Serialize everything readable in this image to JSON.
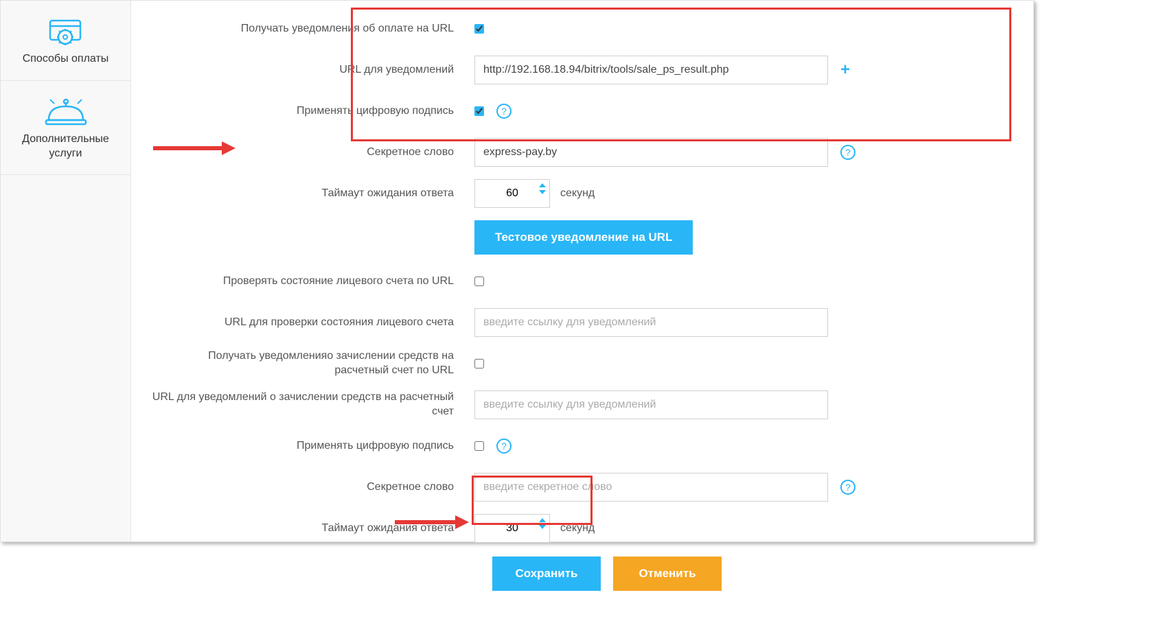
{
  "sidebar": {
    "items": [
      {
        "label": "Способы оплаты"
      },
      {
        "label": "Дополнительные услуги"
      }
    ]
  },
  "form": {
    "notify_url_checkbox_label": "Получать уведомления об оплате на URL",
    "notify_url_label": "URL для уведомлений",
    "notify_url_value": "http://192.168.18.94/bitrix/tools/sale_ps_result.php",
    "apply_signature_label": "Применять цифровую подпись",
    "secret_word_label": "Секретное слово",
    "secret_word_value": "express-pay.by",
    "timeout_label": "Таймаут ожидания ответа",
    "timeout_value": "60",
    "timeout_unit": "секунд",
    "test_button": "Тестовое уведомление на URL",
    "check_account_label": "Проверять состояние лицевого счета по URL",
    "check_url_label": "URL для проверки состояния лицевого счета",
    "check_url_placeholder": "введите ссылку для уведомлений",
    "credit_notify_label": "Получать уведомленияо зачислении средств на расчетный счет по URL",
    "credit_url_label": "URL для уведомлений о зачислении средств на расчетный счет",
    "credit_url_placeholder": "введите ссылку для уведомлений",
    "apply_signature2_label": "Применять цифровую подпись",
    "secret_word2_label": "Секретное слово",
    "secret_word2_placeholder": "введите секретное слово",
    "timeout2_label": "Таймаут ожидания ответа",
    "timeout2_value": "30",
    "timeout2_unit": "секунд",
    "save_button": "Сохранить",
    "cancel_button": "Отменить"
  }
}
